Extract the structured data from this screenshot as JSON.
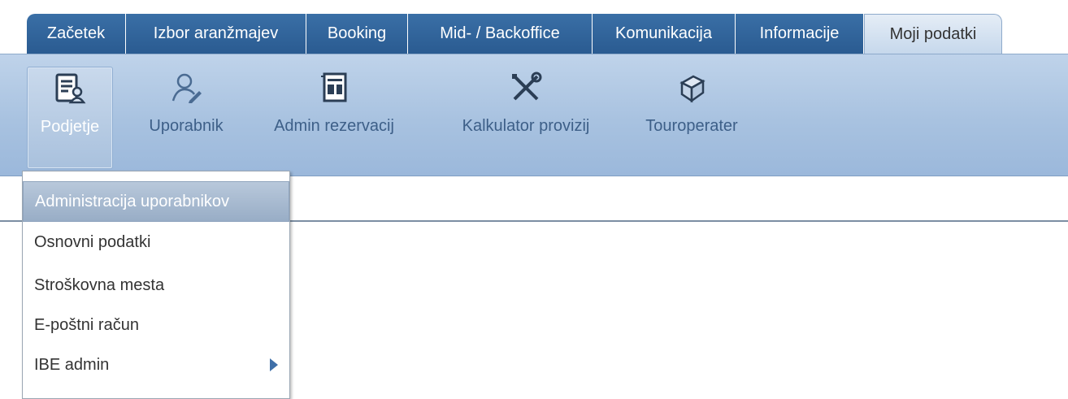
{
  "tabs": [
    {
      "label": "Začetek",
      "active": false
    },
    {
      "label": "Izbor aranžmajev",
      "active": false
    },
    {
      "label": "Booking",
      "active": false
    },
    {
      "label": "Mid- / Backoffice",
      "active": false
    },
    {
      "label": "Komunikacija",
      "active": false
    },
    {
      "label": "Informacije",
      "active": false
    },
    {
      "label": "Moji podatki",
      "active": true
    }
  ],
  "ribbon": {
    "items": [
      {
        "label": "Podjetje",
        "icon": "company-document-icon",
        "selected": true
      },
      {
        "label": "Uporabnik",
        "icon": "user-edit-icon",
        "selected": false
      },
      {
        "label": "Admin rezervacij",
        "icon": "booking-admin-icon",
        "selected": false
      },
      {
        "label": "Kalkulator provizij",
        "icon": "tools-icon",
        "selected": false
      },
      {
        "label": "Touroperater",
        "icon": "touroperator-icon",
        "selected": false
      }
    ]
  },
  "dropdown": {
    "items": [
      {
        "label": "Administracija uporabnikov",
        "highlighted": true,
        "has_submenu": false
      },
      {
        "label": "Osnovni podatki",
        "highlighted": false,
        "has_submenu": false
      },
      {
        "label": "Stroškovna mesta",
        "highlighted": false,
        "has_submenu": false
      },
      {
        "label": "E-poštni račun",
        "highlighted": false,
        "has_submenu": false
      },
      {
        "label": "IBE admin",
        "highlighted": false,
        "has_submenu": true
      }
    ]
  },
  "colors": {
    "tab_bg": "#2f6398",
    "ribbon_bg": "#a8c2e0",
    "ribbon_text": "#3d5f88",
    "highlight_bg": "#a7bad1"
  }
}
